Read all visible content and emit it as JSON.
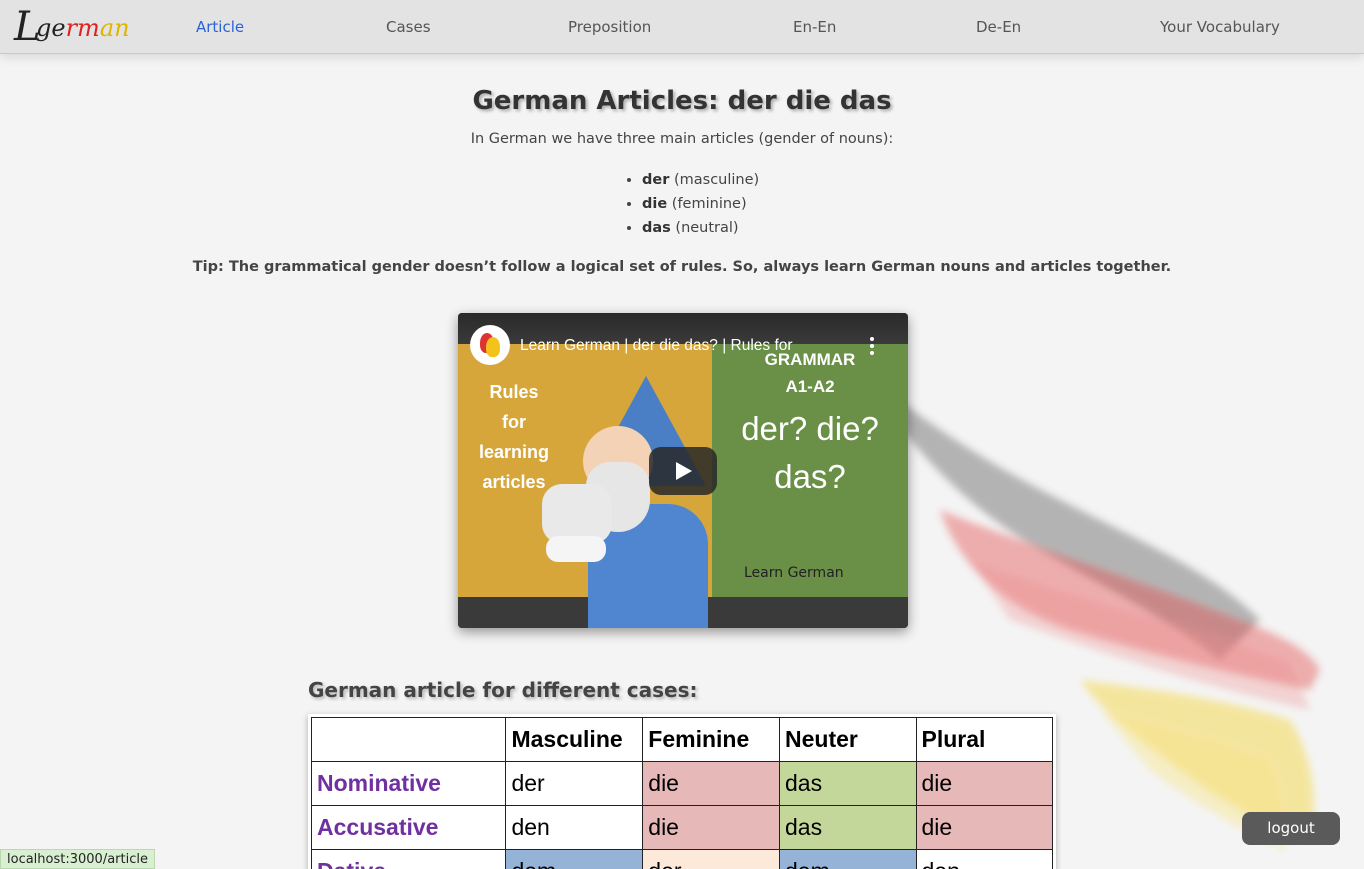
{
  "nav": {
    "logo_text": "Lgerman",
    "items": [
      {
        "label": "Article",
        "active": true
      },
      {
        "label": "Cases",
        "active": false
      },
      {
        "label": "Preposition",
        "active": false
      },
      {
        "label": "En-En",
        "active": false
      },
      {
        "label": "De-En",
        "active": false
      },
      {
        "label": "Your Vocabulary",
        "active": false
      }
    ]
  },
  "main": {
    "title": "German Articles: der die das",
    "intro": "In German we have three main articles (gender of nouns):",
    "articles": [
      {
        "word": "der",
        "gender": "(masculine)"
      },
      {
        "word": "die",
        "gender": "(feminine)"
      },
      {
        "word": "das",
        "gender": "(neutral)"
      }
    ],
    "tip": "Tip: The grammatical gender doesn’t follow a logical set of rules. So, always learn German nouns and articles together."
  },
  "video": {
    "title": "Learn German | der die das? | Rules for",
    "thumb_left_lines": [
      "Rules",
      "for",
      "learning",
      "articles"
    ],
    "thumb_grammar": [
      "GRAMMAR",
      "A1-A2"
    ],
    "thumb_questions": [
      "der? die?",
      "das?"
    ],
    "thumb_brand": "Learn German"
  },
  "cases": {
    "heading": "German article for different cases:",
    "headers": [
      "",
      "Masculine",
      "Feminine",
      "Neuter",
      "Plural"
    ],
    "rows": [
      {
        "case": "Nominative",
        "values": [
          "der",
          "die",
          "das",
          "die"
        ]
      },
      {
        "case": "Accusative",
        "values": [
          "den",
          "die",
          "das",
          "die"
        ]
      },
      {
        "case": "Dative",
        "values": [
          "dem",
          "der",
          "dem",
          "den"
        ]
      }
    ]
  },
  "colors": {
    "accent": "#2a63d6",
    "feminine": "#e6b8b7",
    "neuter": "#c4d79b",
    "case_name": "#7030a0"
  },
  "logout_label": "logout",
  "status_url": "localhost:3000/article"
}
